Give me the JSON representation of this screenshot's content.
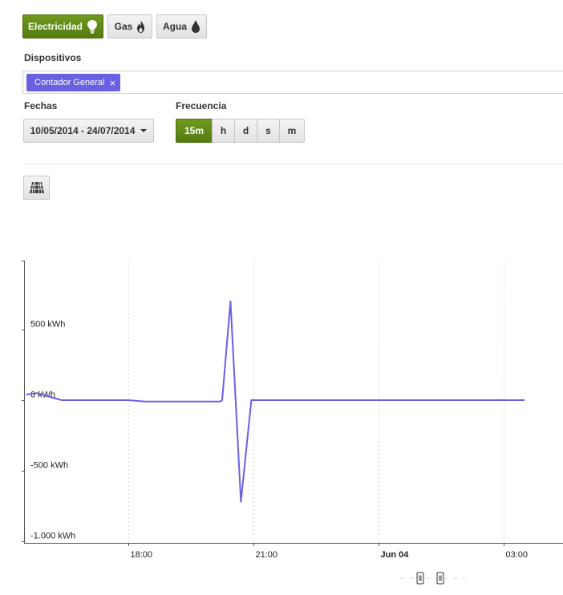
{
  "utilities": {
    "electricity": "Electricidad",
    "gas": "Gas",
    "water": "Agua"
  },
  "devices": {
    "label": "Dispositivos",
    "selected_tag": "Contador General",
    "remove_symbol": "×"
  },
  "dates": {
    "label": "Fechas",
    "range": "10/05/2014 - 24/07/2014"
  },
  "frequency": {
    "label": "Frecuencia",
    "options": [
      "15m",
      "h",
      "d",
      "s",
      "m"
    ],
    "selected": "15m"
  },
  "toolbar": {
    "table_icon": "grid-table-icon"
  },
  "colors": {
    "accent_green": "#5f8a17",
    "series": "#6b5fe3"
  },
  "chart_data": {
    "type": "line",
    "title": "",
    "xlabel": "",
    "ylabel": "",
    "y_ticks": [
      {
        "value": 500,
        "label": "500 kWh"
      },
      {
        "value": 0,
        "label": "0 kWh"
      },
      {
        "value": -500,
        "label": "-500 kWh"
      },
      {
        "value": -1000,
        "label": "-1.000 kWh"
      }
    ],
    "x_ticks": [
      {
        "hour": 18,
        "label": "18:00",
        "bold": false
      },
      {
        "hour": 21,
        "label": "21:00",
        "bold": false
      },
      {
        "hour": 24,
        "label": "Jun 04",
        "bold": true
      },
      {
        "hour": 27,
        "label": "03:00",
        "bold": false
      }
    ],
    "ylim": [
      -1000,
      1000
    ],
    "grid": "vertical-dashed",
    "legend": "none",
    "series": [
      {
        "x": [
          15.55,
          15.8,
          16.4,
          18.0,
          18.4,
          20.2,
          20.25,
          20.45,
          20.7,
          20.95,
          21.0,
          27.5
        ],
        "y": [
          40,
          50,
          0,
          0,
          -10,
          -10,
          0,
          700,
          -720,
          0,
          0,
          0
        ]
      }
    ]
  }
}
